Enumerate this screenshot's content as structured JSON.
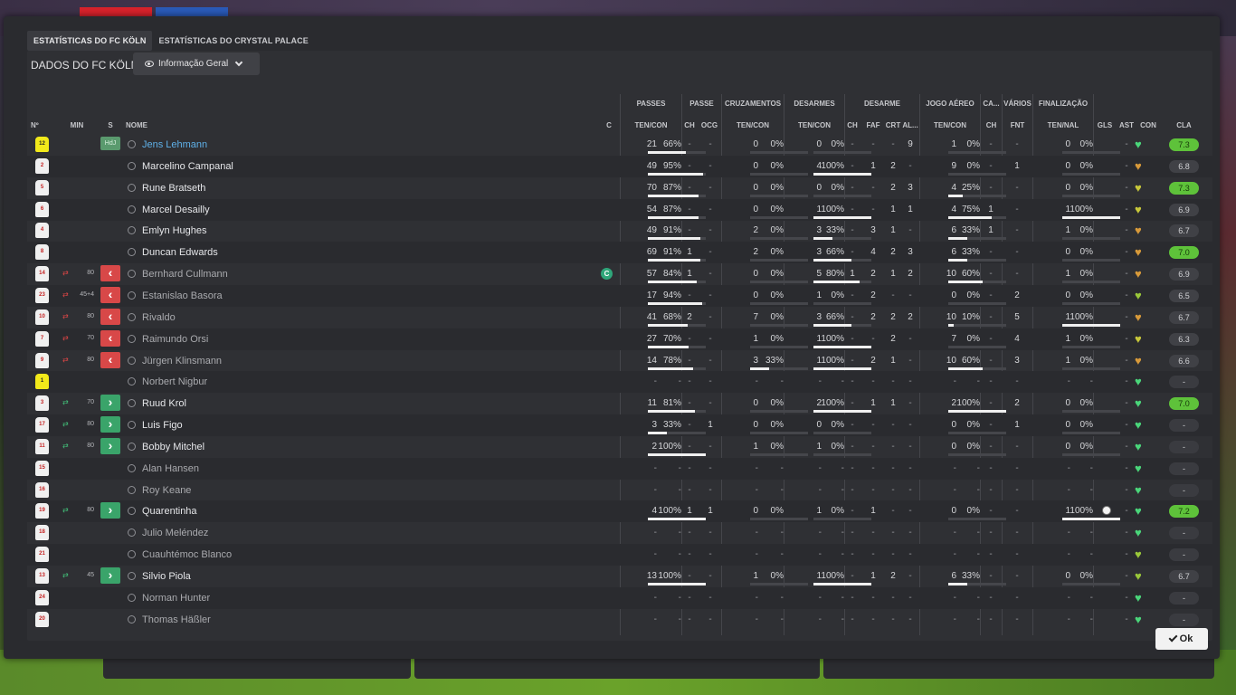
{
  "tabs": [
    "ESTATÍSTICAS DO FC KÖLN",
    "ESTATÍSTICAS DO CRYSTAL PALACE"
  ],
  "title": "DADOS DO FC KÖLN",
  "view_dropdown": "Informação Geral",
  "ok_label": "Ok",
  "group_headers": {
    "passes": "PASSES",
    "passe": "PASSE",
    "cruz": "CRUZAMENTOS",
    "des": "DESARMES",
    "desarme": "DESARME",
    "jogo": "JOGO AÉREO",
    "ca": "CA...",
    "varios": "VÁRIOS",
    "fin": "FINALIZAÇÃO"
  },
  "col_headers": {
    "num": "Nº",
    "min": "MIN",
    "s": "S",
    "nome": "NOME",
    "c": "C",
    "passes": "TEN/CON",
    "passe_ch": "CH",
    "passe_ocg": "OCG",
    "cruz": "TEN/CON",
    "des": "TEN/CON",
    "d_ch": "CH",
    "d_faf": "FAF",
    "d_crt": "CRT",
    "d_al": "AL...",
    "jogo": "TEN/CON",
    "ca_ch": "CH",
    "fnt": "FNT",
    "fin": "TEN/NAL",
    "gls": "GLS",
    "ast": "AST",
    "con": "CON",
    "cla": "CLA"
  },
  "players": [
    {
      "num": "12",
      "gk": true,
      "min": "",
      "sub": "hdj",
      "hdj": "HdJ",
      "name": "Jens Lehmann",
      "style": "link",
      "c": "",
      "p_t": "21",
      "p_c": "66%",
      "p_bar": 66,
      "pc": "-",
      "po": "-",
      "cr_t": "0",
      "cr_c": "0%",
      "cr_bar": 0,
      "de_t": "0",
      "de_c": "0%",
      "de_bar": 0,
      "dch": "-",
      "faf": "-",
      "crt": "-",
      "al": "9",
      "ja_t": "1",
      "ja_c": "0%",
      "ja_bar": 0,
      "cach": "-",
      "fnt": "-",
      "fi_t": "0",
      "fi_c": "0%",
      "fi_bar": 0,
      "gls": "",
      "ast": "-",
      "heart": "#4ad67a",
      "rating": "7.3",
      "rclass": "good"
    },
    {
      "num": "2",
      "gk": false,
      "min": "",
      "sub": "",
      "name": "Marcelino Campanal",
      "style": "",
      "c": "",
      "p_t": "49",
      "p_c": "95%",
      "p_bar": 95,
      "pc": "-",
      "po": "-",
      "cr_t": "0",
      "cr_c": "0%",
      "cr_bar": 0,
      "de_t": "4",
      "de_c": "100%",
      "de_bar": 100,
      "dch": "-",
      "faf": "1",
      "crt": "2",
      "al": "-",
      "ja_t": "9",
      "ja_c": "0%",
      "ja_bar": 0,
      "cach": "-",
      "fnt": "1",
      "fi_t": "0",
      "fi_c": "0%",
      "fi_bar": 0,
      "gls": "",
      "ast": "-",
      "heart": "#d89a3a",
      "rating": "6.8",
      "rclass": "avg"
    },
    {
      "num": "5",
      "gk": false,
      "min": "",
      "sub": "",
      "name": "Rune Bratseth",
      "style": "",
      "c": "",
      "p_t": "70",
      "p_c": "87%",
      "p_bar": 87,
      "pc": "-",
      "po": "-",
      "cr_t": "0",
      "cr_c": "0%",
      "cr_bar": 0,
      "de_t": "0",
      "de_c": "0%",
      "de_bar": 0,
      "dch": "-",
      "faf": "-",
      "crt": "2",
      "al": "3",
      "ja_t": "4",
      "ja_c": "25%",
      "ja_bar": 25,
      "cach": "-",
      "fnt": "-",
      "fi_t": "0",
      "fi_c": "0%",
      "fi_bar": 0,
      "gls": "",
      "ast": "-",
      "heart": "#c8c83a",
      "rating": "7.3",
      "rclass": "good"
    },
    {
      "num": "6",
      "gk": false,
      "min": "",
      "sub": "",
      "name": "Marcel Desailly",
      "style": "",
      "c": "",
      "p_t": "54",
      "p_c": "87%",
      "p_bar": 87,
      "pc": "-",
      "po": "-",
      "cr_t": "0",
      "cr_c": "0%",
      "cr_bar": 0,
      "de_t": "1",
      "de_c": "100%",
      "de_bar": 100,
      "dch": "-",
      "faf": "-",
      "crt": "1",
      "al": "1",
      "ja_t": "4",
      "ja_c": "75%",
      "ja_bar": 75,
      "cach": "1",
      "fnt": "-",
      "fi_t": "1",
      "fi_c": "100%",
      "fi_bar": 100,
      "gls": "",
      "ast": "-",
      "heart": "#c8c83a",
      "rating": "6.9",
      "rclass": "avg"
    },
    {
      "num": "4",
      "gk": false,
      "min": "",
      "sub": "",
      "name": "Emlyn Hughes",
      "style": "",
      "c": "",
      "p_t": "49",
      "p_c": "91%",
      "p_bar": 91,
      "pc": "-",
      "po": "-",
      "cr_t": "2",
      "cr_c": "0%",
      "cr_bar": 0,
      "de_t": "3",
      "de_c": "33%",
      "de_bar": 33,
      "dch": "-",
      "faf": "3",
      "crt": "1",
      "al": "-",
      "ja_t": "6",
      "ja_c": "33%",
      "ja_bar": 33,
      "cach": "1",
      "fnt": "-",
      "fi_t": "1",
      "fi_c": "0%",
      "fi_bar": 0,
      "gls": "",
      "ast": "-",
      "heart": "#d89a3a",
      "rating": "6.7",
      "rclass": "avg"
    },
    {
      "num": "8",
      "gk": false,
      "min": "",
      "sub": "",
      "name": "Duncan Edwards",
      "style": "",
      "c": "",
      "p_t": "69",
      "p_c": "91%",
      "p_bar": 91,
      "pc": "1",
      "po": "-",
      "cr_t": "2",
      "cr_c": "0%",
      "cr_bar": 0,
      "de_t": "3",
      "de_c": "66%",
      "de_bar": 66,
      "dch": "-",
      "faf": "4",
      "crt": "2",
      "al": "3",
      "ja_t": "6",
      "ja_c": "33%",
      "ja_bar": 33,
      "cach": "-",
      "fnt": "-",
      "fi_t": "0",
      "fi_c": "0%",
      "fi_bar": 0,
      "gls": "",
      "ast": "-",
      "heart": "#d89a3a",
      "rating": "7.0",
      "rclass": "good"
    },
    {
      "num": "14",
      "gk": false,
      "min": "80",
      "sub": "out",
      "name": "Bernhard Cullmann",
      "style": "dim",
      "c": "C",
      "p_t": "57",
      "p_c": "84%",
      "p_bar": 84,
      "pc": "1",
      "po": "-",
      "cr_t": "0",
      "cr_c": "0%",
      "cr_bar": 0,
      "de_t": "5",
      "de_c": "80%",
      "de_bar": 80,
      "dch": "1",
      "faf": "2",
      "crt": "1",
      "al": "2",
      "ja_t": "10",
      "ja_c": "60%",
      "ja_bar": 60,
      "cach": "-",
      "fnt": "-",
      "fi_t": "1",
      "fi_c": "0%",
      "fi_bar": 0,
      "gls": "",
      "ast": "-",
      "heart": "#d89a3a",
      "rating": "6.9",
      "rclass": "avg"
    },
    {
      "num": "23",
      "gk": false,
      "min": "45+4",
      "sub": "out",
      "name": "Estanislao Basora",
      "style": "dim",
      "c": "",
      "p_t": "17",
      "p_c": "94%",
      "p_bar": 94,
      "pc": "-",
      "po": "-",
      "cr_t": "0",
      "cr_c": "0%",
      "cr_bar": 0,
      "de_t": "1",
      "de_c": "0%",
      "de_bar": 0,
      "dch": "-",
      "faf": "2",
      "crt": "-",
      "al": "-",
      "ja_t": "0",
      "ja_c": "0%",
      "ja_bar": 0,
      "cach": "-",
      "fnt": "2",
      "fi_t": "0",
      "fi_c": "0%",
      "fi_bar": 0,
      "gls": "",
      "ast": "-",
      "heart": "#9ac83a",
      "rating": "6.5",
      "rclass": "avg"
    },
    {
      "num": "10",
      "gk": false,
      "min": "80",
      "sub": "out",
      "name": "Rivaldo",
      "style": "dim",
      "c": "",
      "p_t": "41",
      "p_c": "68%",
      "p_bar": 68,
      "pc": "2",
      "po": "-",
      "cr_t": "7",
      "cr_c": "0%",
      "cr_bar": 0,
      "de_t": "3",
      "de_c": "66%",
      "de_bar": 66,
      "dch": "-",
      "faf": "2",
      "crt": "2",
      "al": "2",
      "ja_t": "10",
      "ja_c": "10%",
      "ja_bar": 10,
      "cach": "-",
      "fnt": "5",
      "fi_t": "1",
      "fi_c": "100%",
      "fi_bar": 100,
      "gls": "",
      "ast": "-",
      "heart": "#d89a3a",
      "rating": "6.7",
      "rclass": "avg"
    },
    {
      "num": "7",
      "gk": false,
      "min": "70",
      "sub": "out",
      "name": "Raimundo Orsi",
      "style": "dim",
      "c": "",
      "p_t": "27",
      "p_c": "70%",
      "p_bar": 70,
      "pc": "-",
      "po": "-",
      "cr_t": "1",
      "cr_c": "0%",
      "cr_bar": 0,
      "de_t": "1",
      "de_c": "100%",
      "de_bar": 100,
      "dch": "-",
      "faf": "-",
      "crt": "2",
      "al": "-",
      "ja_t": "7",
      "ja_c": "0%",
      "ja_bar": 0,
      "cach": "-",
      "fnt": "4",
      "fi_t": "1",
      "fi_c": "0%",
      "fi_bar": 0,
      "gls": "",
      "ast": "-",
      "heart": "#c8c83a",
      "rating": "6.3",
      "rclass": "avg"
    },
    {
      "num": "9",
      "gk": false,
      "min": "80",
      "sub": "out",
      "name": "Jürgen Klinsmann",
      "style": "dim",
      "c": "",
      "p_t": "14",
      "p_c": "78%",
      "p_bar": 78,
      "pc": "-",
      "po": "-",
      "cr_t": "3",
      "cr_c": "33%",
      "cr_bar": 33,
      "de_t": "1",
      "de_c": "100%",
      "de_bar": 100,
      "dch": "-",
      "faf": "2",
      "crt": "1",
      "al": "-",
      "ja_t": "10",
      "ja_c": "60%",
      "ja_bar": 60,
      "cach": "-",
      "fnt": "3",
      "fi_t": "1",
      "fi_c": "0%",
      "fi_bar": 0,
      "gls": "",
      "ast": "-",
      "heart": "#d89a3a",
      "rating": "6.6",
      "rclass": "avg"
    },
    {
      "num": "1",
      "gk": true,
      "min": "",
      "sub": "",
      "name": "Norbert Nigbur",
      "style": "dim",
      "c": "",
      "p_t": "-",
      "p_c": "-",
      "p_bar": -1,
      "pc": "-",
      "po": "-",
      "cr_t": "-",
      "cr_c": "-",
      "cr_bar": -1,
      "de_t": "-",
      "de_c": "-",
      "de_bar": -1,
      "dch": "-",
      "faf": "-",
      "crt": "-",
      "al": "-",
      "ja_t": "-",
      "ja_c": "-",
      "ja_bar": -1,
      "cach": "-",
      "fnt": "-",
      "fi_t": "-",
      "fi_c": "-",
      "fi_bar": -1,
      "gls": "",
      "ast": "-",
      "heart": "#4ad67a",
      "rating": "-",
      "rclass": ""
    },
    {
      "num": "3",
      "gk": false,
      "min": "70",
      "sub": "in",
      "name": "Ruud Krol",
      "style": "",
      "c": "",
      "p_t": "11",
      "p_c": "81%",
      "p_bar": 81,
      "pc": "-",
      "po": "-",
      "cr_t": "0",
      "cr_c": "0%",
      "cr_bar": 0,
      "de_t": "2",
      "de_c": "100%",
      "de_bar": 100,
      "dch": "-",
      "faf": "1",
      "crt": "1",
      "al": "-",
      "ja_t": "2",
      "ja_c": "100%",
      "ja_bar": 100,
      "cach": "-",
      "fnt": "2",
      "fi_t": "0",
      "fi_c": "0%",
      "fi_bar": 0,
      "gls": "",
      "ast": "-",
      "heart": "#4ad67a",
      "rating": "7.0",
      "rclass": "good"
    },
    {
      "num": "17",
      "gk": false,
      "min": "80",
      "sub": "in",
      "name": "Luis Figo",
      "style": "",
      "c": "",
      "p_t": "3",
      "p_c": "33%",
      "p_bar": 33,
      "pc": "-",
      "po": "1",
      "cr_t": "0",
      "cr_c": "0%",
      "cr_bar": 0,
      "de_t": "0",
      "de_c": "0%",
      "de_bar": 0,
      "dch": "-",
      "faf": "-",
      "crt": "-",
      "al": "-",
      "ja_t": "0",
      "ja_c": "0%",
      "ja_bar": 0,
      "cach": "-",
      "fnt": "1",
      "fi_t": "0",
      "fi_c": "0%",
      "fi_bar": 0,
      "gls": "",
      "ast": "-",
      "heart": "#4ad67a",
      "rating": "-",
      "rclass": ""
    },
    {
      "num": "11",
      "gk": false,
      "min": "80",
      "sub": "in",
      "name": "Bobby Mitchel",
      "style": "",
      "c": "",
      "p_t": "2",
      "p_c": "100%",
      "p_bar": 100,
      "pc": "-",
      "po": "-",
      "cr_t": "1",
      "cr_c": "0%",
      "cr_bar": 0,
      "de_t": "1",
      "de_c": "0%",
      "de_bar": 0,
      "dch": "-",
      "faf": "-",
      "crt": "-",
      "al": "-",
      "ja_t": "0",
      "ja_c": "0%",
      "ja_bar": 0,
      "cach": "-",
      "fnt": "-",
      "fi_t": "0",
      "fi_c": "0%",
      "fi_bar": 0,
      "gls": "",
      "ast": "-",
      "heart": "#4ad67a",
      "rating": "-",
      "rclass": ""
    },
    {
      "num": "15",
      "gk": false,
      "min": "",
      "sub": "",
      "name": "Alan Hansen",
      "style": "dim",
      "c": "",
      "p_t": "-",
      "p_c": "-",
      "p_bar": -1,
      "pc": "-",
      "po": "-",
      "cr_t": "-",
      "cr_c": "-",
      "cr_bar": -1,
      "de_t": "-",
      "de_c": "-",
      "de_bar": -1,
      "dch": "-",
      "faf": "-",
      "crt": "-",
      "al": "-",
      "ja_t": "-",
      "ja_c": "-",
      "ja_bar": -1,
      "cach": "-",
      "fnt": "-",
      "fi_t": "-",
      "fi_c": "-",
      "fi_bar": -1,
      "gls": "",
      "ast": "-",
      "heart": "#4ad67a",
      "rating": "-",
      "rclass": ""
    },
    {
      "num": "16",
      "gk": false,
      "min": "",
      "sub": "",
      "name": "Roy Keane",
      "style": "dim",
      "c": "",
      "p_t": "-",
      "p_c": "-",
      "p_bar": -1,
      "pc": "-",
      "po": "-",
      "cr_t": "-",
      "cr_c": "-",
      "cr_bar": -1,
      "de_t": "-",
      "de_c": "-",
      "de_bar": -1,
      "dch": "-",
      "faf": "-",
      "crt": "-",
      "al": "-",
      "ja_t": "-",
      "ja_c": "-",
      "ja_bar": -1,
      "cach": "-",
      "fnt": "-",
      "fi_t": "-",
      "fi_c": "-",
      "fi_bar": -1,
      "gls": "",
      "ast": "-",
      "heart": "#4ad67a",
      "rating": "-",
      "rclass": ""
    },
    {
      "num": "19",
      "gk": false,
      "min": "80",
      "sub": "in",
      "name": "Quarentinha",
      "style": "",
      "c": "",
      "p_t": "4",
      "p_c": "100%",
      "p_bar": 100,
      "pc": "1",
      "po": "1",
      "cr_t": "0",
      "cr_c": "0%",
      "cr_bar": 0,
      "de_t": "1",
      "de_c": "0%",
      "de_bar": 0,
      "dch": "-",
      "faf": "1",
      "crt": "-",
      "al": "-",
      "ja_t": "0",
      "ja_c": "0%",
      "ja_bar": 0,
      "cach": "-",
      "fnt": "-",
      "fi_t": "1",
      "fi_c": "100%",
      "fi_bar": 100,
      "gls": "ball",
      "ast": "-",
      "heart": "#4ad67a",
      "rating": "7.2",
      "rclass": "good"
    },
    {
      "num": "18",
      "gk": false,
      "min": "",
      "sub": "",
      "name": "Julio Meléndez",
      "style": "dim",
      "c": "",
      "p_t": "-",
      "p_c": "-",
      "p_bar": -1,
      "pc": "-",
      "po": "-",
      "cr_t": "-",
      "cr_c": "-",
      "cr_bar": -1,
      "de_t": "-",
      "de_c": "-",
      "de_bar": -1,
      "dch": "-",
      "faf": "-",
      "crt": "-",
      "al": "-",
      "ja_t": "-",
      "ja_c": "-",
      "ja_bar": -1,
      "cach": "-",
      "fnt": "-",
      "fi_t": "-",
      "fi_c": "-",
      "fi_bar": -1,
      "gls": "",
      "ast": "-",
      "heart": "#4ad67a",
      "rating": "-",
      "rclass": ""
    },
    {
      "num": "21",
      "gk": false,
      "min": "",
      "sub": "",
      "name": "Cuauhtémoc Blanco",
      "style": "dim",
      "c": "",
      "p_t": "-",
      "p_c": "-",
      "p_bar": -1,
      "pc": "-",
      "po": "-",
      "cr_t": "-",
      "cr_c": "-",
      "cr_bar": -1,
      "de_t": "-",
      "de_c": "-",
      "de_bar": -1,
      "dch": "-",
      "faf": "-",
      "crt": "-",
      "al": "-",
      "ja_t": "-",
      "ja_c": "-",
      "ja_bar": -1,
      "cach": "-",
      "fnt": "-",
      "fi_t": "-",
      "fi_c": "-",
      "fi_bar": -1,
      "gls": "",
      "ast": "-",
      "heart": "#9ac83a",
      "rating": "-",
      "rclass": ""
    },
    {
      "num": "13",
      "gk": false,
      "min": "45",
      "sub": "in",
      "name": "Silvio Piola",
      "style": "",
      "c": "",
      "p_t": "13",
      "p_c": "100%",
      "p_bar": 100,
      "pc": "-",
      "po": "-",
      "cr_t": "1",
      "cr_c": "0%",
      "cr_bar": 0,
      "de_t": "1",
      "de_c": "100%",
      "de_bar": 100,
      "dch": "-",
      "faf": "1",
      "crt": "2",
      "al": "-",
      "ja_t": "6",
      "ja_c": "33%",
      "ja_bar": 33,
      "cach": "-",
      "fnt": "-",
      "fi_t": "0",
      "fi_c": "0%",
      "fi_bar": 0,
      "gls": "",
      "ast": "-",
      "heart": "#9ac83a",
      "rating": "6.7",
      "rclass": "avg"
    },
    {
      "num": "24",
      "gk": false,
      "min": "",
      "sub": "",
      "name": "Norman Hunter",
      "style": "dim",
      "c": "",
      "p_t": "-",
      "p_c": "-",
      "p_bar": -1,
      "pc": "-",
      "po": "-",
      "cr_t": "-",
      "cr_c": "-",
      "cr_bar": -1,
      "de_t": "-",
      "de_c": "-",
      "de_bar": -1,
      "dch": "-",
      "faf": "-",
      "crt": "-",
      "al": "-",
      "ja_t": "-",
      "ja_c": "-",
      "ja_bar": -1,
      "cach": "-",
      "fnt": "-",
      "fi_t": "-",
      "fi_c": "-",
      "fi_bar": -1,
      "gls": "",
      "ast": "-",
      "heart": "#4ad67a",
      "rating": "-",
      "rclass": ""
    },
    {
      "num": "20",
      "gk": false,
      "min": "",
      "sub": "",
      "name": "Thomas Häßler",
      "style": "dim",
      "c": "",
      "p_t": "-",
      "p_c": "-",
      "p_bar": -1,
      "pc": "-",
      "po": "-",
      "cr_t": "-",
      "cr_c": "-",
      "cr_bar": -1,
      "de_t": "-",
      "de_c": "-",
      "de_bar": -1,
      "dch": "-",
      "faf": "-",
      "crt": "-",
      "al": "-",
      "ja_t": "-",
      "ja_c": "-",
      "ja_bar": -1,
      "cach": "-",
      "fnt": "-",
      "fi_t": "-",
      "fi_c": "-",
      "fi_bar": -1,
      "gls": "",
      "ast": "-",
      "heart": "#4ad67a",
      "rating": "-",
      "rclass": ""
    }
  ]
}
